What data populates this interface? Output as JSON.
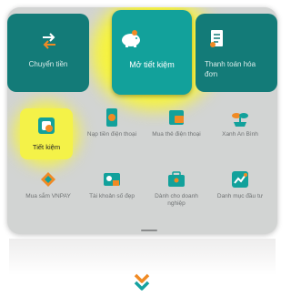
{
  "top_tiles": [
    {
      "label": "Chuyển tiền",
      "icon": "transfer-icon"
    },
    {
      "label": "Mở tiết kiệm",
      "icon": "piggy-bank-icon"
    },
    {
      "label": "Thanh toán hóa đơn",
      "icon": "bill-icon"
    }
  ],
  "grid": {
    "row1": [
      {
        "label": "Tiết kiệm",
        "icon": "savings-icon"
      },
      {
        "label": "Nạp tiền điện thoại",
        "icon": "phone-topup-icon"
      },
      {
        "label": "Mua thẻ điện thoại",
        "icon": "phone-card-icon"
      },
      {
        "label": "Xanh An Bình",
        "icon": "plant-icon"
      }
    ],
    "row2": [
      {
        "label": "Mua sắm VNPAY",
        "icon": "shopping-tag-icon"
      },
      {
        "label": "Tài khoản số đẹp",
        "icon": "account-icon"
      },
      {
        "label": "Dành cho doanh nghiệp",
        "icon": "briefcase-icon"
      },
      {
        "label": "Danh mục đầu tư",
        "icon": "investment-chart-icon"
      }
    ]
  },
  "colors": {
    "teal": "#12a19b",
    "highlight": "#f4f248",
    "orange": "#f08a24",
    "chevron_teal": "#17a2a0"
  },
  "decor": {
    "chevron_icon": "double-chevron-down-icon"
  }
}
